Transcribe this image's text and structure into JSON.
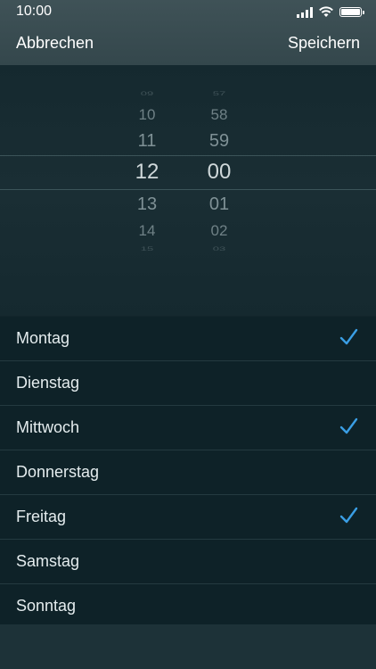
{
  "status_bar": {
    "time": "10:00"
  },
  "nav": {
    "cancel_label": "Abbrechen",
    "save_label": "Speichern"
  },
  "picker": {
    "hours": [
      "09",
      "10",
      "11",
      "12",
      "13",
      "14",
      "15"
    ],
    "minutes": [
      "57",
      "58",
      "59",
      "00",
      "01",
      "02",
      "03"
    ],
    "selected_hour": "12",
    "selected_minute": "00"
  },
  "days": [
    {
      "label": "Montag",
      "checked": true
    },
    {
      "label": "Dienstag",
      "checked": false
    },
    {
      "label": "Mittwoch",
      "checked": true
    },
    {
      "label": "Donnerstag",
      "checked": false
    },
    {
      "label": "Freitag",
      "checked": true
    },
    {
      "label": "Samstag",
      "checked": false
    },
    {
      "label": "Sonntag",
      "checked": false
    }
  ],
  "colors": {
    "check": "#3a9ee4",
    "accent": "#ffffff"
  }
}
